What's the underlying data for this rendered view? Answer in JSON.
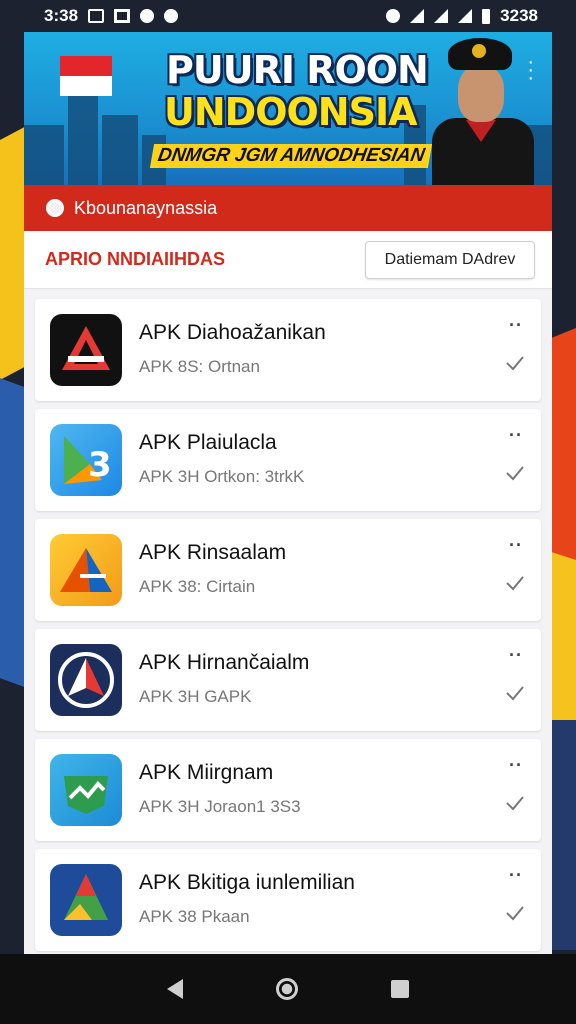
{
  "status_bar": {
    "time_left": "3:38",
    "time_right": "3238"
  },
  "banner": {
    "title_line1": "PUURI ROON",
    "title_line2": "UNDOONSIA",
    "subtitle": "DNMGR JGM AMNODHESIAN"
  },
  "red_bar": {
    "text": "Kbounanaynassia"
  },
  "section": {
    "title": "APRIO NNDIAIIHDAS",
    "sort_button": "Datiemam DAdrev"
  },
  "apps": [
    {
      "name": "APK Diahoažanikan",
      "meta": "APK 8S: Ortnan"
    },
    {
      "name": "APK Plaiulacla",
      "meta": "APK 3H Ortkon: 3trkK"
    },
    {
      "name": "APK Rinsaalam",
      "meta": "APK 38: Cirtain"
    },
    {
      "name": "APK Hirnančaialm",
      "meta": "APK 3H GAPK"
    },
    {
      "name": "APK Miirgnam",
      "meta": "APK 3H Joraon1 3S3"
    },
    {
      "name": "APK Bkitiga iunlemilian",
      "meta": "APK 38 Pkaan"
    }
  ],
  "colors": {
    "accent_red": "#d12a1b",
    "banner_blue": "#1eaee3",
    "title_yellow": "#ffe11a"
  }
}
